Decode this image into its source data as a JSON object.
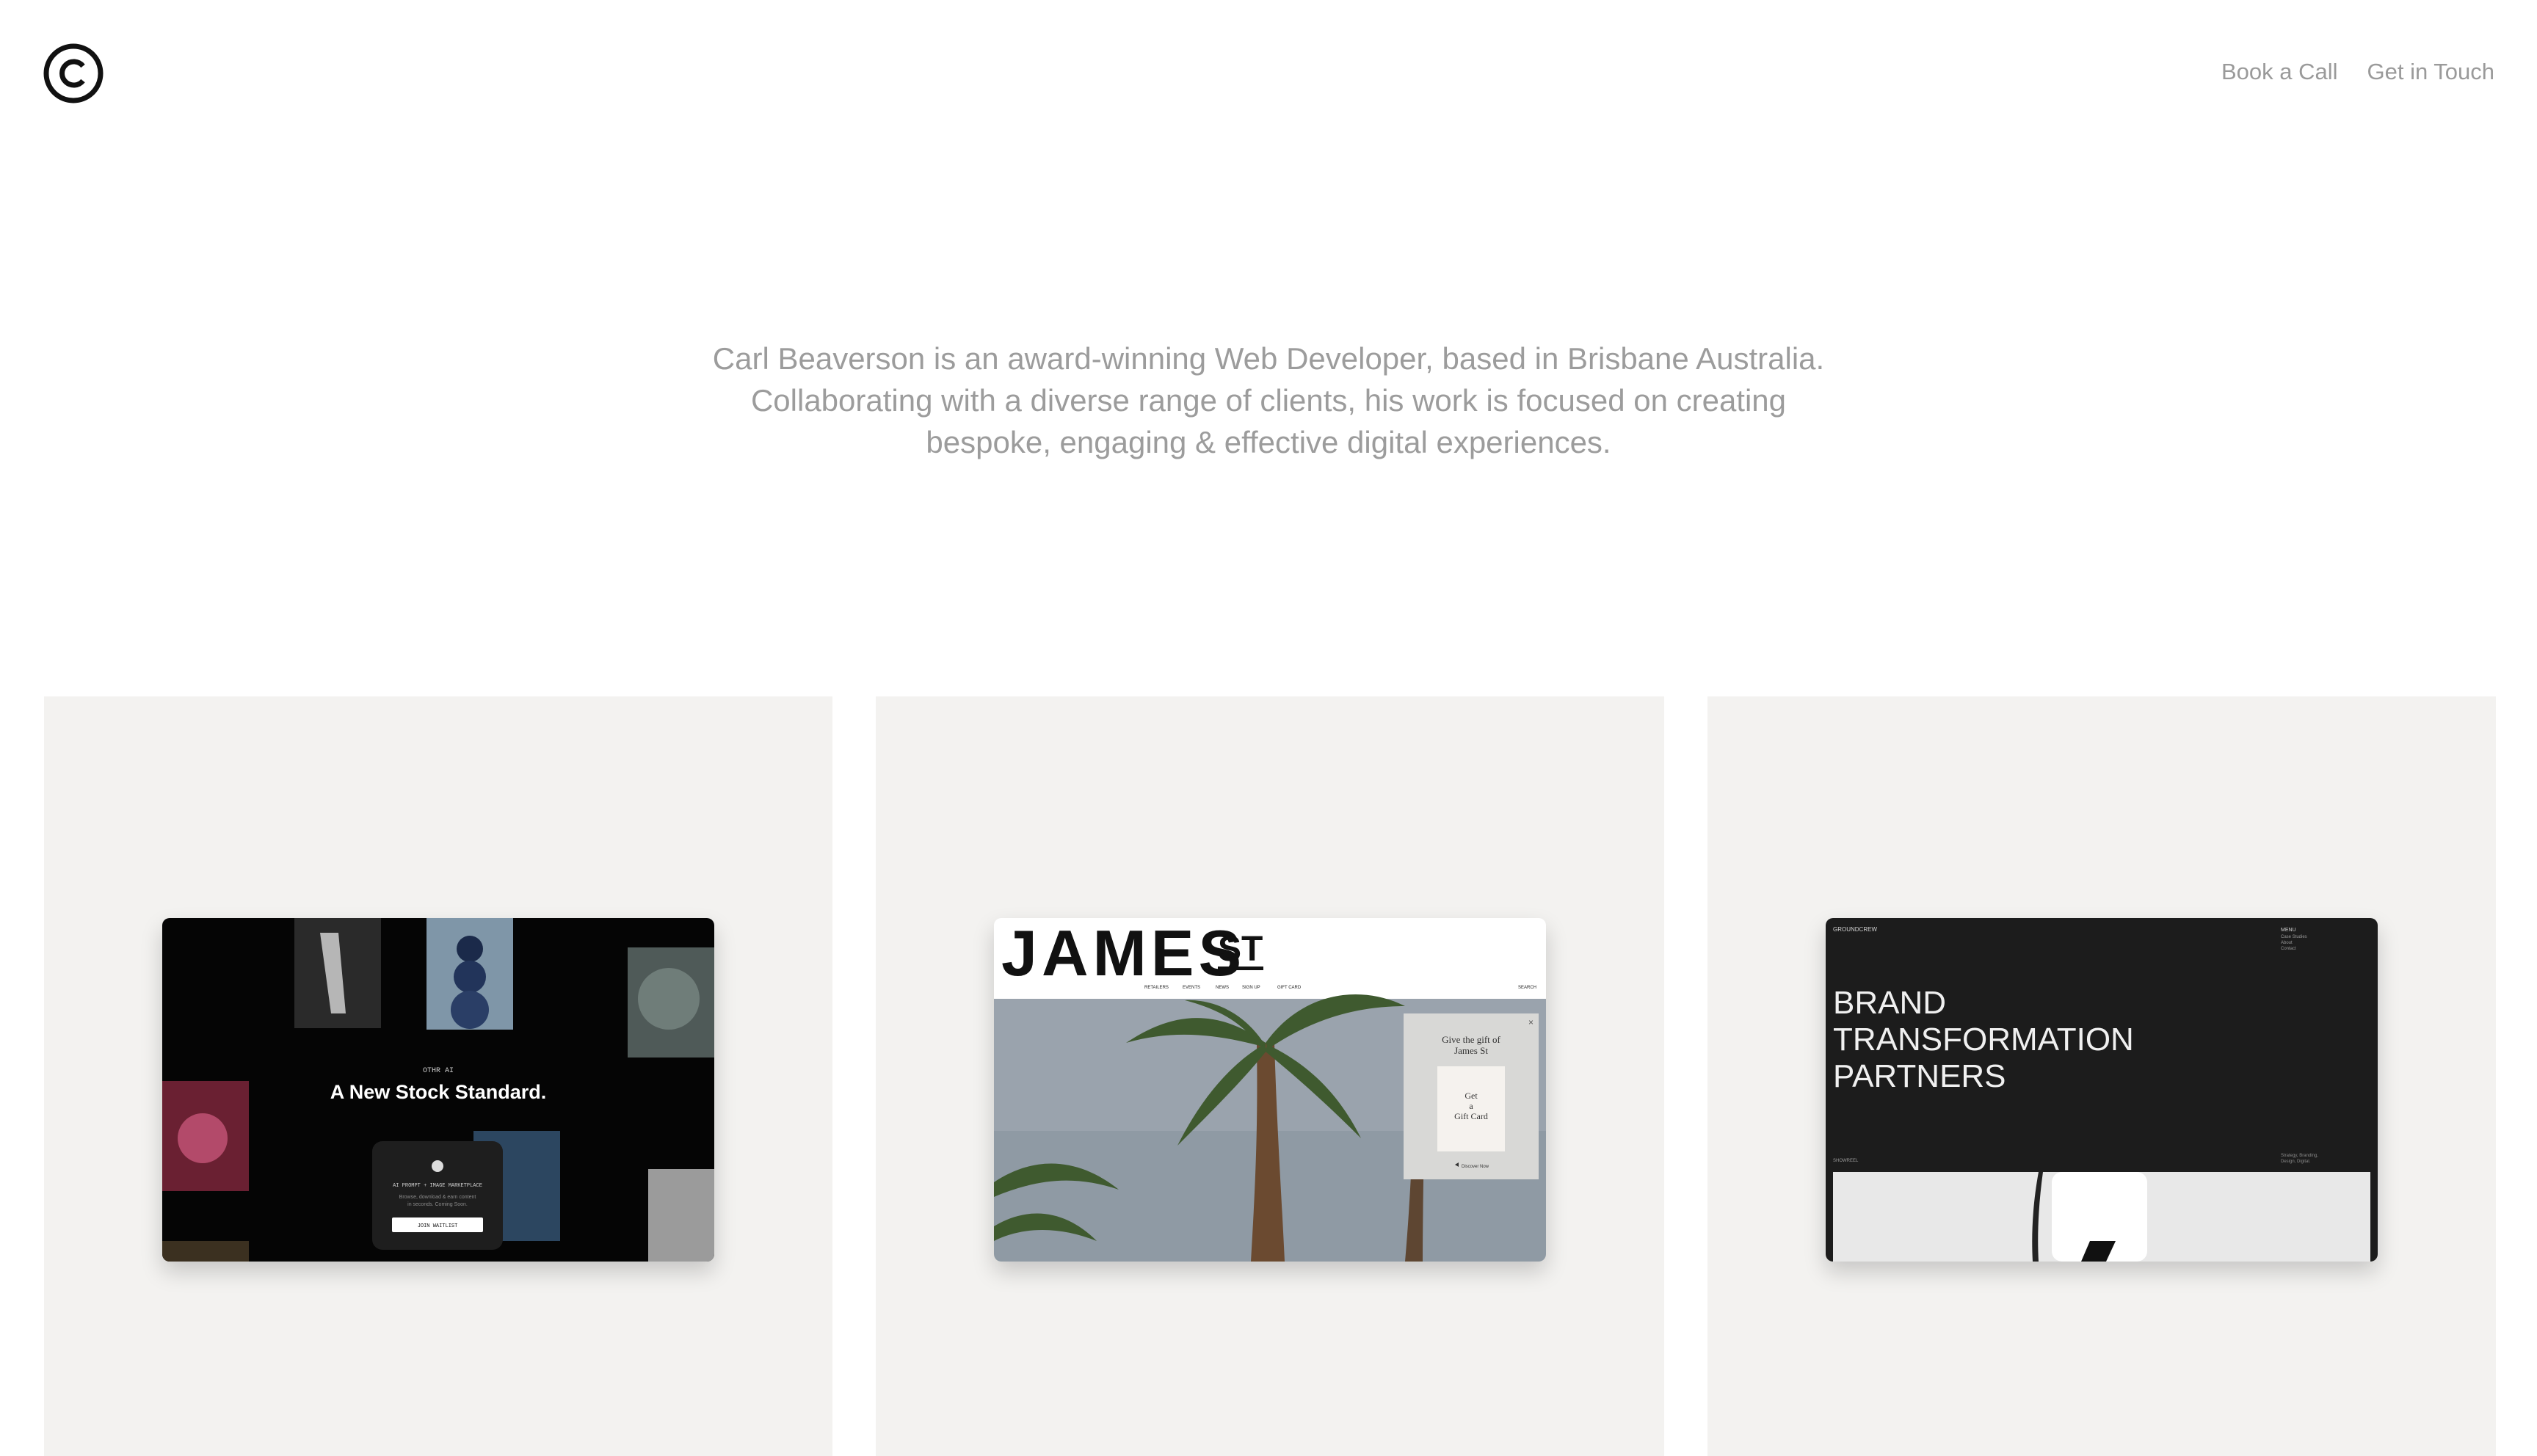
{
  "header": {
    "logo_icon": "copyright-icon",
    "nav": [
      {
        "label": "Book a Call"
      },
      {
        "label": "Get in Touch"
      }
    ]
  },
  "intro": {
    "lines": [
      "Carl Beaverson is an award-winning Web Developer, based in Brisbane Australia.",
      "Collaborating with a diverse range of clients, his work is focused on creating",
      "bespoke, engaging & effective digital experiences."
    ]
  },
  "projects": [
    {
      "eyebrow": "OTHR AI",
      "headline": "A New Stock Standard.",
      "panel_title": "AI PROMPT + IMAGE MARKETPLACE",
      "panel_text_1": "Browse, download & earn content",
      "panel_text_2": "in seconds. Coming Soon.",
      "panel_button": "JOIN WAITLIST"
    },
    {
      "brand": "JAMES",
      "brand_suffix": "ST",
      "nav": [
        "RETAILERS",
        "EVENTS",
        "NEWS",
        "SIGN UP",
        "GIFT CARD"
      ],
      "search": "SEARCH",
      "popup_line_1": "Give the gift of",
      "popup_line_2": "James St",
      "card_line_1": "Get",
      "card_line_2": "a",
      "card_line_3": "Gift Card",
      "popup_link": "Discover Now",
      "popup_close": "×"
    },
    {
      "brand": "GROUNDCREW",
      "menu": "MENU",
      "menu_items": [
        "Case Studies",
        "About",
        "Contact"
      ],
      "headline_lines": [
        "BRAND",
        "TRANSFORMATION",
        "PARTNERS"
      ],
      "footer_left": "SHOWREEL",
      "footer_right_1": "Strategy, Branding,",
      "footer_right_2": "Design, Digital."
    }
  ],
  "colors": {
    "background": "#ffffff",
    "card": "#f3f2f0",
    "text_muted": "#9a9a9a"
  }
}
